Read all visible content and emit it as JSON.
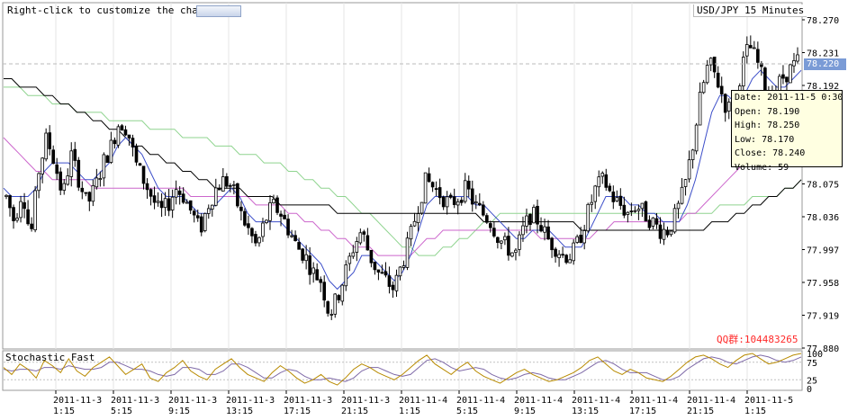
{
  "hint_text": "Right-click to customize the chart",
  "title": "USD/JPY  15 Minutes",
  "current_price": "78.220",
  "watermark": "QQ群:104483265",
  "stoch_title": "Stochastic Fast",
  "tooltip": {
    "date": "Date: 2011-11-5 0:30",
    "open": "Open: 78.190",
    "high": "High: 78.250",
    "low": "Low: 78.170",
    "close": "Close: 78.240",
    "volume": "Volume: 59"
  },
  "colors": {
    "candle": "#000000",
    "ma_fast": "#3c4ec9",
    "ma_magenta": "#cc66cc",
    "ma_green": "#8fd48f",
    "ma_black": "#000000",
    "stoch_k": "#b88a00",
    "stoch_d": "#7f6aa8",
    "tooltip_bg": "#ffffe1",
    "current_price_bg": "#7a9bd6"
  },
  "chart_data": {
    "type": "candlestick",
    "y_ticks": [
      "78.270",
      "78.231",
      "78.192",
      "78.153",
      "78.114",
      "78.075",
      "78.036",
      "77.997",
      "77.958",
      "77.919",
      "77.880"
    ],
    "ylim": [
      77.88,
      78.27
    ],
    "x_ticks": [
      {
        "date": "2011-11-3",
        "time": "1:15"
      },
      {
        "date": "2011-11-3",
        "time": "5:15"
      },
      {
        "date": "2011-11-3",
        "time": "9:15"
      },
      {
        "date": "2011-11-3",
        "time": "13:15"
      },
      {
        "date": "2011-11-3",
        "time": "17:15"
      },
      {
        "date": "2011-11-3",
        "time": "21:15"
      },
      {
        "date": "2011-11-4",
        "time": "1:15"
      },
      {
        "date": "2011-11-4",
        "time": "5:15"
      },
      {
        "date": "2011-11-4",
        "time": "9:15"
      },
      {
        "date": "2011-11-4",
        "time": "13:15"
      },
      {
        "date": "2011-11-4",
        "time": "17:15"
      },
      {
        "date": "2011-11-4",
        "time": "21:15"
      },
      {
        "date": "2011-11-5",
        "time": "1:15"
      }
    ],
    "price_path": [
      78.06,
      78.03,
      78.07,
      78.01,
      78.09,
      78.13,
      78.1,
      78.06,
      78.11,
      78.08,
      78.05,
      78.07,
      78.1,
      78.12,
      78.15,
      78.14,
      78.1,
      78.08,
      78.06,
      78.04,
      78.05,
      78.07,
      78.06,
      78.04,
      78.02,
      78.05,
      78.07,
      78.08,
      78.07,
      78.04,
      78.02,
      78.0,
      78.03,
      78.05,
      78.04,
      78.02,
      78.0,
      77.99,
      77.97,
      77.96,
      77.92,
      77.94,
      77.97,
      78.0,
      78.02,
      77.99,
      77.97,
      77.96,
      77.95,
      77.98,
      78.01,
      78.05,
      78.08,
      78.07,
      78.06,
      78.05,
      78.06,
      78.07,
      78.05,
      78.04,
      78.03,
      78.01,
      78.0,
      77.99,
      78.02,
      78.04,
      78.03,
      78.01,
      78.0,
      77.99,
      77.99,
      78.01,
      78.04,
      78.07,
      78.08,
      78.06,
      78.05,
      78.04,
      78.05,
      78.04,
      78.03,
      78.02,
      78.02,
      78.04,
      78.07,
      78.12,
      78.18,
      78.22,
      78.2,
      78.17,
      78.16,
      78.21,
      78.24,
      78.22,
      78.19,
      78.18,
      78.2,
      78.21,
      78.22
    ],
    "ma_fast_path": [
      78.07,
      78.06,
      78.06,
      78.06,
      78.07,
      78.09,
      78.1,
      78.1,
      78.1,
      78.09,
      78.08,
      78.08,
      78.09,
      78.1,
      78.12,
      78.13,
      78.12,
      78.11,
      78.09,
      78.07,
      78.06,
      78.06,
      78.06,
      78.05,
      78.04,
      78.04,
      78.05,
      78.06,
      78.07,
      78.06,
      78.04,
      78.03,
      78.03,
      78.03,
      78.03,
      78.02,
      78.01,
      78.0,
      77.99,
      77.98,
      77.96,
      77.95,
      77.96,
      77.97,
      77.99,
      77.99,
      77.98,
      77.97,
      77.96,
      77.97,
      77.99,
      78.02,
      78.05,
      78.06,
      78.06,
      78.06,
      78.06,
      78.06,
      78.05,
      78.05,
      78.04,
      78.03,
      78.02,
      78.01,
      78.01,
      78.02,
      78.02,
      78.02,
      78.01,
      78.0,
      78.0,
      78.0,
      78.02,
      78.04,
      78.06,
      78.06,
      78.06,
      78.05,
      78.05,
      78.04,
      78.04,
      78.03,
      78.03,
      78.03,
      78.05,
      78.08,
      78.12,
      78.16,
      78.18,
      78.18,
      78.17,
      78.18,
      78.2,
      78.21,
      78.2,
      78.19,
      78.19,
      78.2,
      78.21
    ],
    "ma_magenta_path": [
      78.13,
      78.12,
      78.11,
      78.1,
      78.09,
      78.09,
      78.08,
      78.08,
      78.08,
      78.08,
      78.08,
      78.07,
      78.07,
      78.07,
      78.07,
      78.07,
      78.07,
      78.07,
      78.07,
      78.07,
      78.07,
      78.07,
      78.07,
      78.06,
      78.06,
      78.06,
      78.06,
      78.06,
      78.06,
      78.06,
      78.06,
      78.05,
      78.05,
      78.05,
      78.05,
      78.04,
      78.04,
      78.03,
      78.03,
      78.02,
      78.02,
      78.01,
      78.01,
      78.0,
      78.0,
      78.0,
      77.99,
      77.99,
      77.99,
      77.99,
      77.99,
      78.0,
      78.01,
      78.01,
      78.02,
      78.02,
      78.02,
      78.02,
      78.02,
      78.02,
      78.02,
      78.02,
      78.02,
      78.02,
      78.02,
      78.02,
      78.01,
      78.01,
      78.01,
      78.01,
      78.01,
      78.01,
      78.01,
      78.02,
      78.02,
      78.03,
      78.03,
      78.03,
      78.03,
      78.03,
      78.03,
      78.03,
      78.03,
      78.03,
      78.04,
      78.04,
      78.05,
      78.06,
      78.07,
      78.08,
      78.09,
      78.1,
      78.11,
      78.12,
      78.13,
      78.14,
      78.15,
      78.16,
      78.17
    ],
    "ma_green_path": [
      78.19,
      78.19,
      78.19,
      78.18,
      78.18,
      78.18,
      78.17,
      78.17,
      78.17,
      78.16,
      78.16,
      78.16,
      78.16,
      78.15,
      78.15,
      78.15,
      78.15,
      78.15,
      78.14,
      78.14,
      78.14,
      78.14,
      78.13,
      78.13,
      78.13,
      78.13,
      78.12,
      78.12,
      78.12,
      78.11,
      78.11,
      78.11,
      78.1,
      78.1,
      78.1,
      78.09,
      78.09,
      78.08,
      78.08,
      78.07,
      78.07,
      78.06,
      78.06,
      78.05,
      78.04,
      78.04,
      78.03,
      78.02,
      78.01,
      78.0,
      78.0,
      77.99,
      77.99,
      77.99,
      78.0,
      78.0,
      78.01,
      78.01,
      78.02,
      78.03,
      78.03,
      78.04,
      78.04,
      78.04,
      78.04,
      78.04,
      78.04,
      78.04,
      78.04,
      78.04,
      78.04,
      78.04,
      78.04,
      78.04,
      78.04,
      78.04,
      78.04,
      78.04,
      78.04,
      78.04,
      78.04,
      78.04,
      78.04,
      78.04,
      78.04,
      78.04,
      78.04,
      78.04,
      78.05,
      78.05,
      78.05,
      78.05,
      78.06,
      78.06,
      78.06,
      78.06,
      78.07,
      78.07,
      78.08
    ],
    "ma_black_path": [
      78.2,
      78.2,
      78.19,
      78.19,
      78.19,
      78.18,
      78.18,
      78.17,
      78.17,
      78.16,
      78.16,
      78.15,
      78.15,
      78.14,
      78.14,
      78.13,
      78.12,
      78.12,
      78.11,
      78.11,
      78.1,
      78.1,
      78.09,
      78.09,
      78.08,
      78.08,
      78.07,
      78.07,
      78.07,
      78.07,
      78.06,
      78.06,
      78.06,
      78.06,
      78.05,
      78.05,
      78.05,
      78.05,
      78.05,
      78.05,
      78.05,
      78.04,
      78.04,
      78.04,
      78.04,
      78.04,
      78.04,
      78.04,
      78.04,
      78.04,
      78.04,
      78.04,
      78.04,
      78.04,
      78.04,
      78.04,
      78.04,
      78.04,
      78.04,
      78.03,
      78.03,
      78.03,
      78.03,
      78.03,
      78.03,
      78.03,
      78.03,
      78.03,
      78.03,
      78.03,
      78.03,
      78.02,
      78.02,
      78.02,
      78.02,
      78.02,
      78.02,
      78.02,
      78.02,
      78.02,
      78.02,
      78.02,
      78.02,
      78.02,
      78.02,
      78.02,
      78.02,
      78.03,
      78.03,
      78.03,
      78.04,
      78.04,
      78.05,
      78.05,
      78.06,
      78.06,
      78.07,
      78.07,
      78.08
    ],
    "stoch_ylim": [
      0,
      100
    ],
    "stoch_ticks": [
      "100",
      "75",
      "25",
      "0"
    ],
    "stoch_k_path": [
      60,
      40,
      70,
      55,
      30,
      80,
      65,
      45,
      85,
      50,
      35,
      60,
      75,
      90,
      65,
      40,
      55,
      70,
      30,
      20,
      45,
      60,
      80,
      50,
      35,
      25,
      55,
      70,
      85,
      60,
      40,
      30,
      20,
      45,
      65,
      50,
      30,
      15,
      25,
      40,
      20,
      10,
      30,
      55,
      70,
      60,
      45,
      35,
      25,
      40,
      60,
      80,
      95,
      70,
      55,
      40,
      60,
      75,
      50,
      35,
      25,
      15,
      30,
      45,
      55,
      40,
      30,
      20,
      25,
      35,
      45,
      60,
      80,
      90,
      70,
      50,
      40,
      55,
      45,
      30,
      25,
      20,
      35,
      55,
      75,
      90,
      95,
      85,
      70,
      60,
      80,
      95,
      100,
      85,
      70,
      75,
      85,
      95,
      100
    ],
    "stoch_d_path": [
      55,
      50,
      55,
      55,
      50,
      60,
      60,
      55,
      65,
      60,
      55,
      55,
      60,
      75,
      75,
      65,
      55,
      55,
      50,
      40,
      35,
      40,
      60,
      60,
      55,
      40,
      40,
      50,
      70,
      70,
      60,
      45,
      30,
      30,
      45,
      55,
      50,
      35,
      25,
      25,
      30,
      25,
      20,
      30,
      50,
      60,
      60,
      50,
      40,
      35,
      40,
      60,
      80,
      85,
      75,
      60,
      50,
      55,
      60,
      55,
      40,
      30,
      25,
      30,
      40,
      45,
      40,
      30,
      25,
      25,
      35,
      45,
      60,
      75,
      80,
      70,
      55,
      45,
      45,
      45,
      35,
      25,
      25,
      35,
      55,
      70,
      85,
      90,
      85,
      75,
      70,
      80,
      90,
      95,
      90,
      80,
      75,
      80,
      90
    ]
  }
}
